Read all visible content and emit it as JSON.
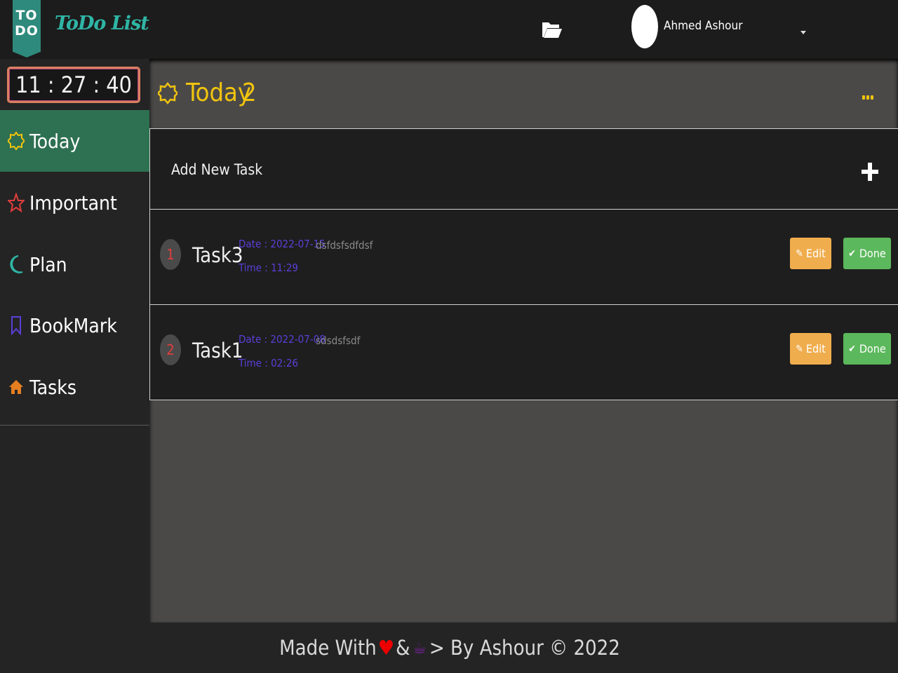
{
  "header": {
    "logo_badge_top": "TO",
    "logo_badge_bottom": "DO",
    "logo_text": "ToDo List",
    "user_name": "Ahmed Ashour"
  },
  "sidebar": {
    "clock": "11 : 27 : 40",
    "items": [
      {
        "label": "Today",
        "icon": "sun-icon",
        "color": "#f1c40f",
        "active": true
      },
      {
        "label": "Important",
        "icon": "star-icon",
        "color": "#e23d3d",
        "active": false
      },
      {
        "label": "Plan",
        "icon": "moon-icon",
        "color": "#2fb5a5",
        "active": false
      },
      {
        "label": "BookMark",
        "icon": "bookmark-icon",
        "color": "#5b3fd9",
        "active": false
      },
      {
        "label": "Tasks",
        "icon": "home-icon",
        "color": "#e67e22",
        "active": false
      }
    ]
  },
  "main": {
    "title": "Today",
    "count": "2",
    "add_label": "Add New Task",
    "tasks": [
      {
        "num": "1",
        "name": "Task3",
        "date": "Date : 2022-07-15",
        "time": "Time : 11:29",
        "desc": "dsfdsfsdfdsf",
        "edit_label": "Edit",
        "done_label": "Done"
      },
      {
        "num": "2",
        "name": "Task1",
        "date": "Date : 2022-07-08",
        "time": "Time : 02:26",
        "desc": "sdsdsfsdf",
        "edit_label": "Edit",
        "done_label": "Done"
      }
    ]
  },
  "footer": {
    "made_with": "Made With",
    "amp": "&",
    "by": "> By Ashour © 2022"
  },
  "colors": {
    "accent_yellow": "#f1c40f",
    "active_green": "#2e7052",
    "edit_orange": "#f0ad4e",
    "done_green": "#5cb85c"
  }
}
